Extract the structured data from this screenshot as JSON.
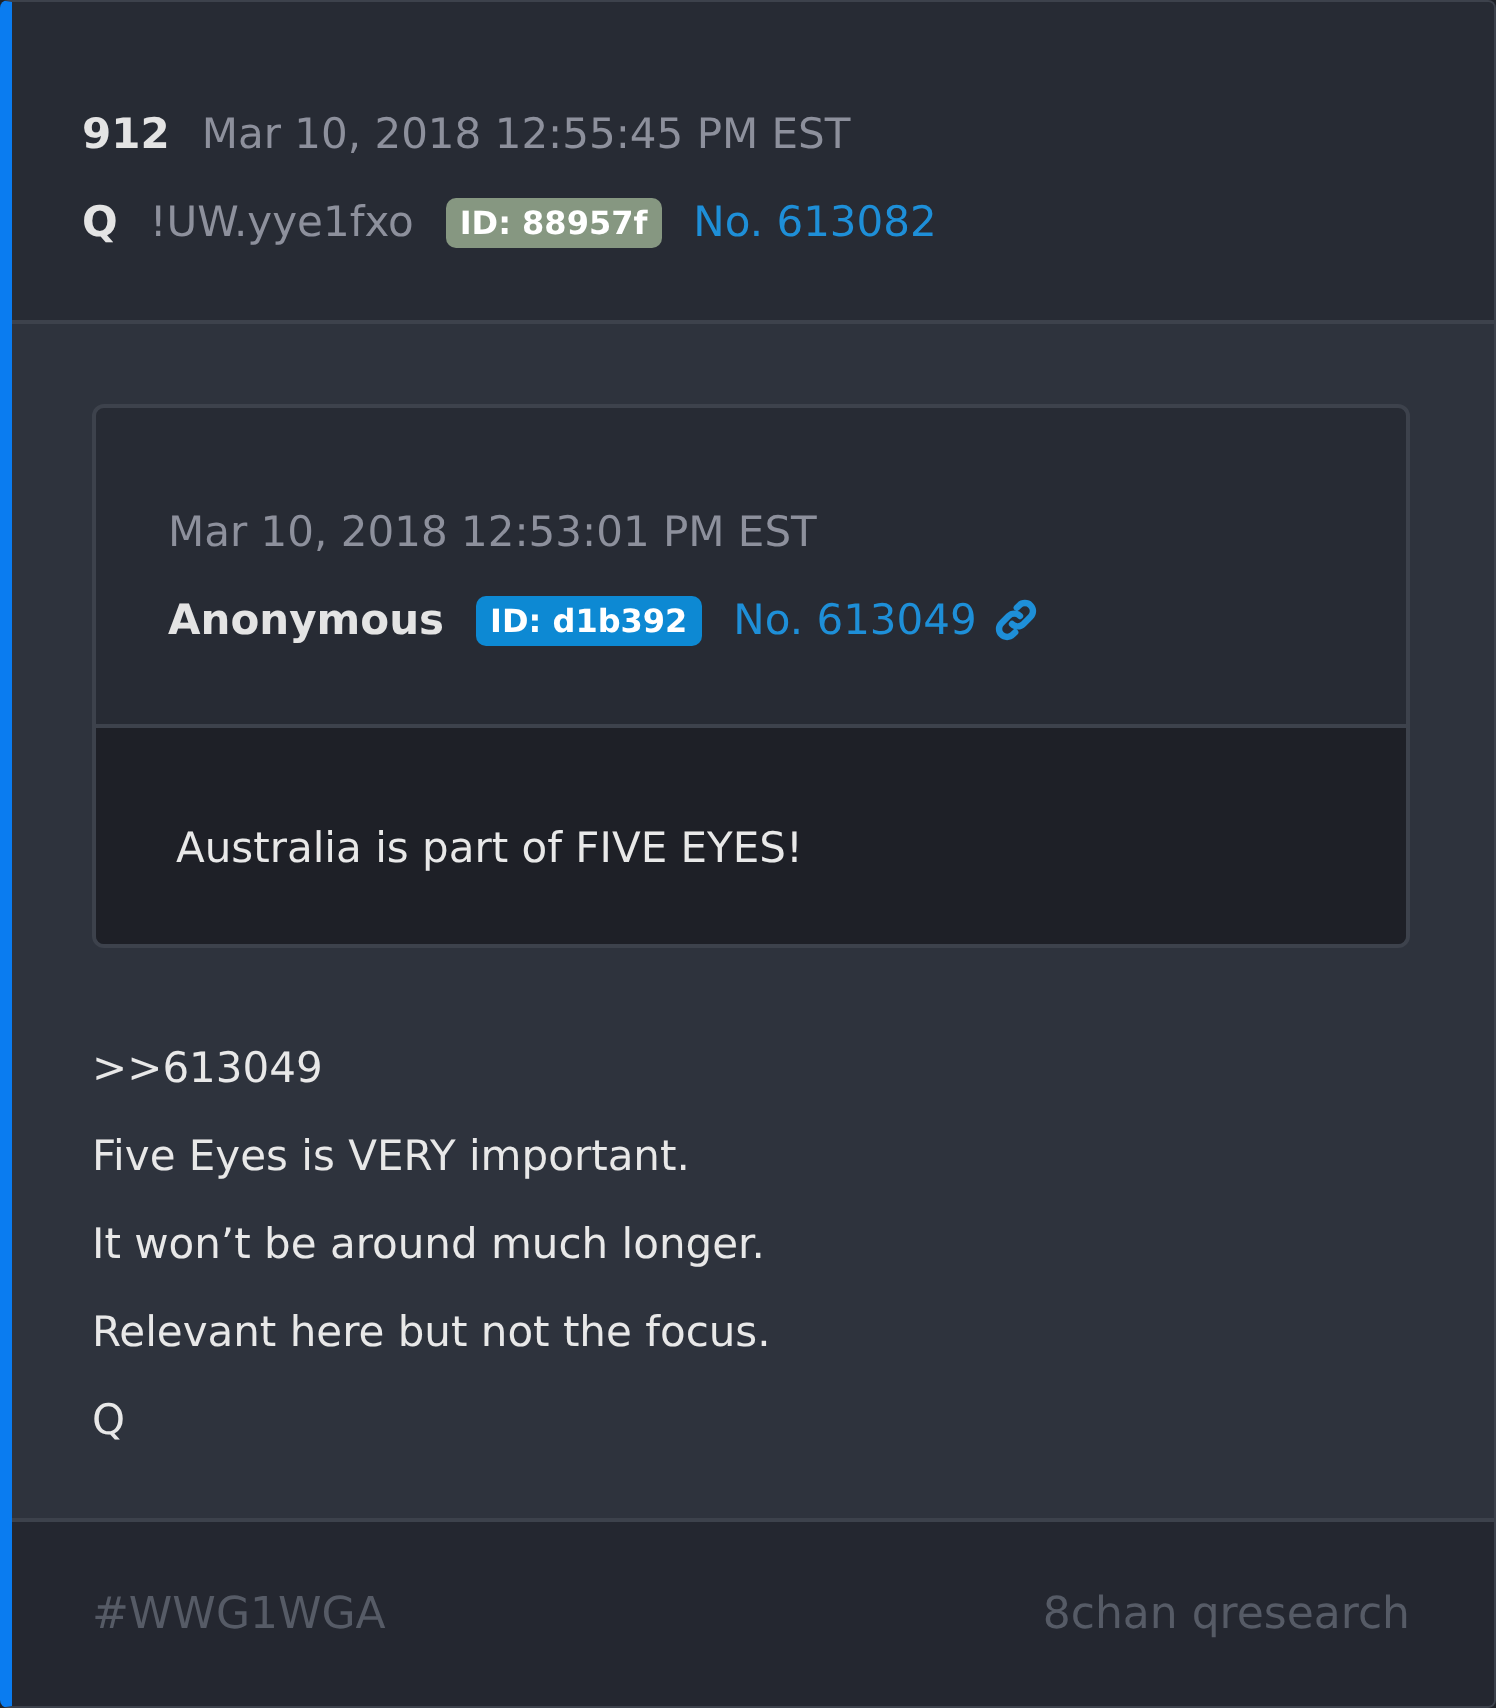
{
  "post": {
    "number": "912",
    "timestamp": "Mar 10, 2018 12:55:45 PM EST",
    "author": "Q",
    "tripcode": "!UW.yye1fxo",
    "id_badge": "ID: 88957f",
    "post_no": "No. 613082"
  },
  "quoted_post": {
    "timestamp": "Mar 10, 2018 12:53:01 PM EST",
    "author": "Anonymous",
    "id_badge": "ID: d1b392",
    "post_no": "No. 613049",
    "text": "Australia is part of FIVE EYES!"
  },
  "body_lines": [
    ">>613049",
    "Five Eyes is VERY important.",
    "It won’t be around much longer.",
    "Relevant here but not the focus.",
    "Q"
  ],
  "footer": {
    "hashtag": "#WWG1WGA",
    "source": "8chan qresearch"
  }
}
